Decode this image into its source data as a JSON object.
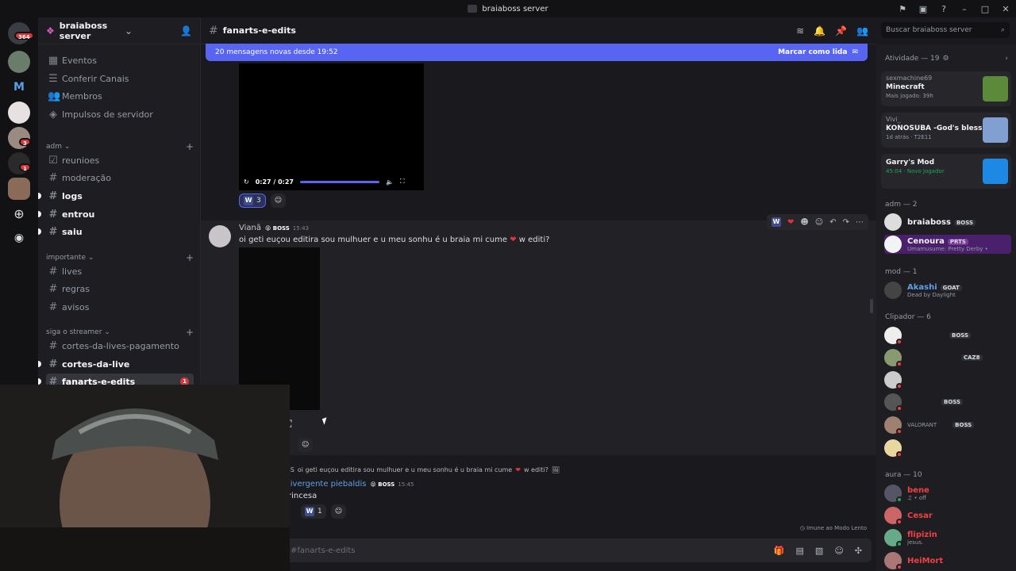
{
  "window": {
    "title": "braiaboss server"
  },
  "servers": {
    "dm_badge": "364",
    "badge_a": "3",
    "badge_b": "1"
  },
  "sidebar": {
    "server_name": "braiaboss server",
    "top_items": [
      "Eventos",
      "Conferir Canais",
      "Membros",
      "Impulsos de servidor"
    ],
    "categories": [
      {
        "name": "adm",
        "channels": [
          "reunioes",
          "moderação",
          "logs",
          "entrou",
          "saiu"
        ]
      },
      {
        "name": "importante",
        "channels": [
          "lives",
          "regras",
          "avisos"
        ]
      },
      {
        "name": "siga o streamer",
        "channels": [
          "cortes-da-lives-pagamento",
          "cortes-da-live",
          "fanarts-e-edits"
        ]
      }
    ],
    "active_badge": "1"
  },
  "header": {
    "channel": "fanarts-e-edits",
    "search_placeholder": "Buscar braiaboss server"
  },
  "new_messages": {
    "text": "20 mensagens novas desde 19:52",
    "action": "Marcar como lida"
  },
  "video1": {
    "time": "0:27 / 0:27",
    "reaction_count": "3",
    "progress": 1.0
  },
  "message": {
    "author": "Vianã",
    "role": "BOSS",
    "time": "15:43",
    "text": "oi geti euçou editira sou mulhuer e u meu sonhu é u braia mi cume",
    "text_end": "w editi?"
  },
  "reply": {
    "ref_role": "BOSS",
    "ref_text": "oi geti euçou editira sou mulhuer e u meu sonhu é u braia mi cume",
    "ref_end": "w editi?",
    "author": "livergente piebaldis",
    "role": "BOSS",
    "time": "15:45",
    "text": "rincesa",
    "reaction_count": "1"
  },
  "composer": {
    "placeholder": "#fanarts-e-edits",
    "slow_mode": "Imune ao Modo Lento"
  },
  "members": {
    "activity_header": "Atividade — 19",
    "activities": [
      {
        "user": "sexmachine69",
        "game": "Minecraft",
        "status": "Mais jogado: 39h"
      },
      {
        "user": "Vivi_",
        "game": "KONOSUBA -God's blessin...",
        "status": "1d atrás · T2E11"
      },
      {
        "user": "",
        "game": "Garry's Mod",
        "status": "45:04 · Novo Jogador"
      }
    ],
    "adm_header": "adm — 2",
    "adm": [
      {
        "name": "braiaboss",
        "tag": "BOSS",
        "sub": ""
      },
      {
        "name": "Cenoura",
        "tag": "PRTS",
        "sub": "Umamusume: Pretty Derby •"
      }
    ],
    "mod_header": "mod — 1",
    "mod": [
      {
        "name": "Akashi",
        "tag": "GOAT",
        "sub": "Dead by Daylight"
      }
    ],
    "clip_header": "Clipador — 6",
    "clip_tags": [
      "BOSS",
      "CAZ8",
      "BOSS",
      "BOSS"
    ],
    "clip_sub": "VALORANT",
    "aura_header": "aura — 10",
    "aura": [
      {
        "name": "bene",
        "sub": "♫ • off",
        "color": "#f23f43"
      },
      {
        "name": "Cesar",
        "sub": "",
        "color": "#f23f43"
      },
      {
        "name": "flipizin",
        "sub": "jesus.",
        "color": "#f23f43"
      },
      {
        "name": "HeiMort",
        "sub": "",
        "color": "#f23f43"
      }
    ]
  }
}
